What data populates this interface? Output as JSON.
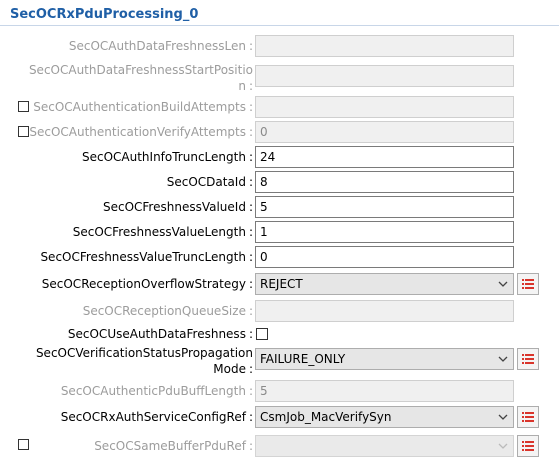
{
  "panel": {
    "title": "SecOCRxPduProcessing_0"
  },
  "fields": {
    "auth_data_freshness_len": {
      "label": "SecOCAuthDataFreshnessLen",
      "value": ""
    },
    "auth_data_freshness_start_position": {
      "label_line1": "SecOCAuthDataFreshnessStartPositio",
      "label_line2": "n",
      "value": ""
    },
    "authentication_build_attempts": {
      "label": "SecOCAuthenticationBuildAttempts",
      "value": ""
    },
    "authentication_verify_attempts": {
      "label": "SecOCAuthenticationVerifyAttempts",
      "value": "0"
    },
    "auth_info_trunc_length": {
      "label": "SecOCAuthInfoTruncLength",
      "value": "24"
    },
    "data_id": {
      "label": "SecOCDataId",
      "value": "8"
    },
    "freshness_value_id": {
      "label": "SecOCFreshnessValueId",
      "value": "5"
    },
    "freshness_value_length": {
      "label": "SecOCFreshnessValueLength",
      "value": "1"
    },
    "freshness_value_trunc_length": {
      "label": "SecOCFreshnessValueTruncLength",
      "value": "0"
    },
    "reception_overflow_strategy": {
      "label": "SecOCReceptionOverflowStrategy",
      "value": "REJECT"
    },
    "reception_queue_size": {
      "label": "SecOCReceptionQueueSize",
      "value": ""
    },
    "use_auth_data_freshness": {
      "label": "SecOCUseAuthDataFreshness",
      "checked": false
    },
    "verification_status_propagation_mode": {
      "label_line1": "SecOCVerificationStatusPropagation",
      "label_line2": "Mode",
      "value": "FAILURE_ONLY"
    },
    "authentic_pdu_buff_length": {
      "label": "SecOCAuthenticPduBuffLength",
      "value": "5"
    },
    "rx_auth_service_config_ref": {
      "label": "SecOCRxAuthServiceConfigRef",
      "value": "CsmJob_MacVerifySyn"
    },
    "same_buffer_pdu_ref": {
      "label": "SecOCSameBufferPduRef",
      "value": ""
    }
  },
  "colon": ":",
  "icons": {
    "dropdown": "chevron-down-icon",
    "reference_list": "list-icon"
  },
  "colors": {
    "title": "#1f5fa6",
    "list_icon": "#d9342b",
    "disabled_text": "#9c9c9c"
  }
}
